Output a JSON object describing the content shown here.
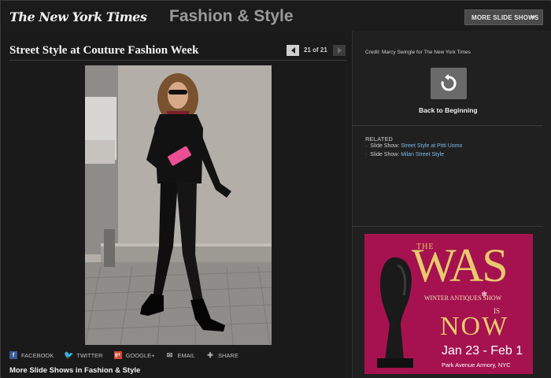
{
  "header": {
    "logo": "The New York Times",
    "section_title": "Fashion & Style",
    "more_slideshows_label": "MORE SLIDE SHOWS"
  },
  "slideshow": {
    "title": "Street Style at Couture Fashion Week",
    "counter": "21 of 21",
    "current": 21,
    "total": 21
  },
  "share": {
    "items": [
      {
        "label": "FACEBOOK",
        "icon": "facebook-icon"
      },
      {
        "label": "TWITTER",
        "icon": "twitter-icon"
      },
      {
        "label": "GOOGLE+",
        "icon": "google-plus-icon"
      },
      {
        "label": "EMAIL",
        "icon": "email-icon"
      },
      {
        "label": "SHARE",
        "icon": "share-icon"
      }
    ]
  },
  "more_shows_label": "More Slide Shows in Fashion & Style",
  "sidebar": {
    "credit": "Credit: Marcy Swingle for The New York Times",
    "back_label": "Back to Beginning",
    "related_heading": "RELATED",
    "related": [
      {
        "prefix": "Slide Show:",
        "link": "Street Style at Pitti Uomo"
      },
      {
        "prefix": "Slide Show:",
        "link": "Milan Street Style"
      }
    ]
  },
  "ad": {
    "the": "THE",
    "was": "WAS",
    "subtitle": "WINTER ANTIQUES SHOW",
    "is": "IS",
    "now": "NOW",
    "dates": "Jan 23 - Feb 1",
    "venue": "Park Avenue Armory, NYC"
  },
  "colors": {
    "background": "#181818",
    "link": "#7cb8e8",
    "ad_background": "#a5124f",
    "ad_gold": "#e9c96e"
  }
}
